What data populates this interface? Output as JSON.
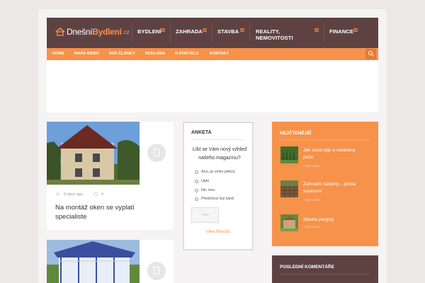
{
  "logo": {
    "part1": "Dnešní",
    "part2": "Bydlení",
    "tld": ".cz"
  },
  "topnav": [
    {
      "label": "BYDLENÍ"
    },
    {
      "label": "ZAHRADA"
    },
    {
      "label": "STAVBA"
    },
    {
      "label_line1": "REALITY,",
      "label_line2": "NEMOVITOSTI"
    },
    {
      "label": "FINANCE"
    }
  ],
  "subnav": [
    "HOME",
    "MAPA WEBU",
    "RSS ČLÁNKY",
    "REKLAMA",
    "O PORTÁLU",
    "KONTAKT"
  ],
  "posts": [
    {
      "date": "9 days ago",
      "comments": "4",
      "title_line1": "Na montáž oken se vyplatí",
      "title_line2": "specialiste"
    }
  ],
  "poll": {
    "heading": "ANKETA",
    "question_line1": "Líbí se Vám nový vzhled",
    "question_line2": "našeho magazínu?",
    "options": [
      "Ano, je velmi pěkný",
      "Ujde",
      "Nic moc",
      "Předchozí byl lepší"
    ],
    "vote_label": "Vote",
    "results_label": "View Results"
  },
  "popular": {
    "heading": "NEJČTENĚJŠÍ",
    "items": [
      {
        "title_line1": "Jak sázet túje a následná",
        "title_line2": "péče",
        "views": "2,186 views"
      },
      {
        "title_line1": "Zahradní zástěny – jistota",
        "title_line2": "soukromí",
        "views": "2,005 views"
      },
      {
        "title_line1": "Stavba pergoly",
        "title_line2": "",
        "views": "1,153 views"
      }
    ]
  },
  "comments": {
    "heading": "POSLEDNÍ KOMENTÁŘE"
  },
  "colors": {
    "brown": "#5e4242",
    "orange": "#f7924a",
    "page": "#ece8e8"
  }
}
